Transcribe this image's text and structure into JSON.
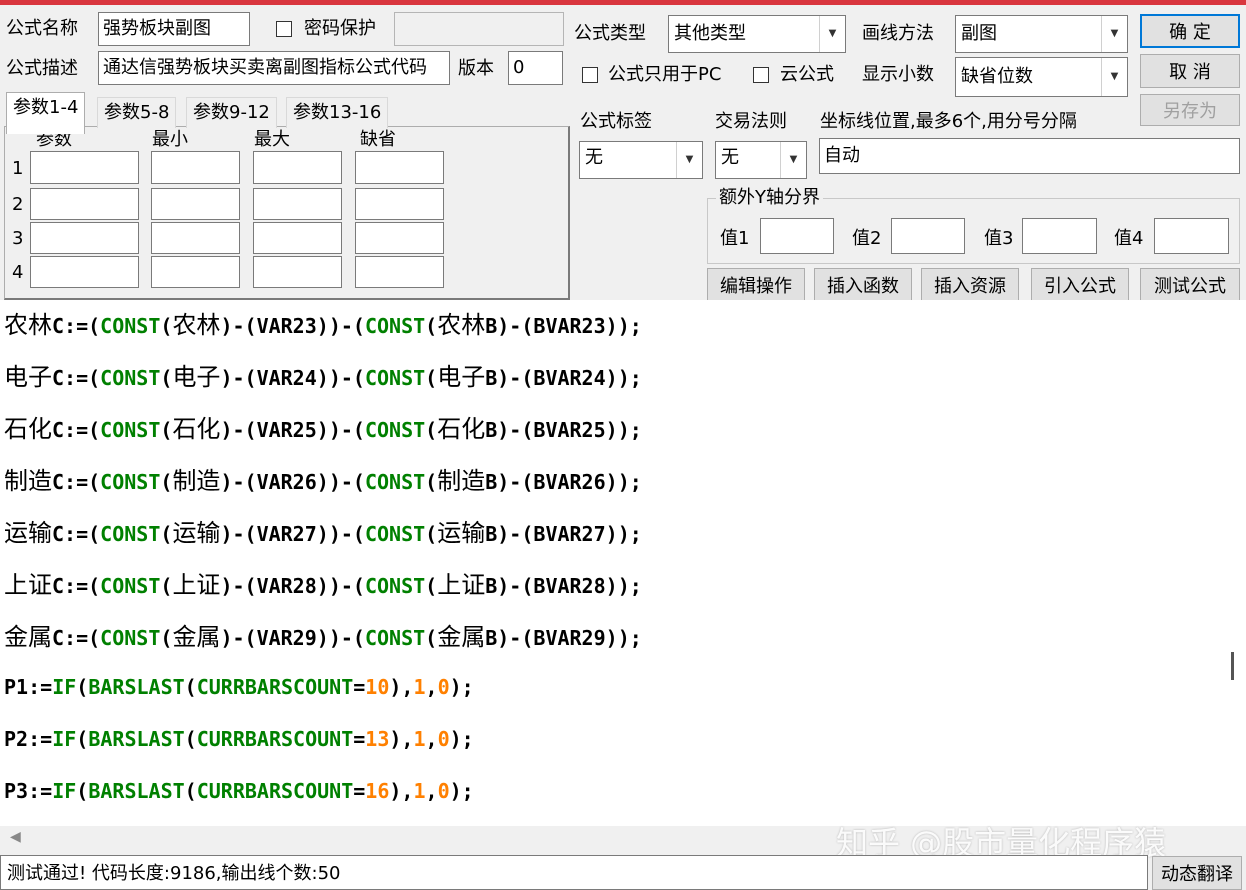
{
  "header": {
    "name_label": "公式名称",
    "name_value": "强势板块副图",
    "password_label": "密码保护",
    "desc_label": "公式描述",
    "desc_value": "通达信强势板块买卖离副图指标公式代码",
    "version_label": "版本",
    "version_value": "0",
    "type_label": "公式类型",
    "type_value": "其他类型",
    "draw_label": "画线方法",
    "draw_value": "副图",
    "pc_only_label": "公式只用于PC",
    "cloud_label": "云公式",
    "decimal_label": "显示小数",
    "decimal_value": "缺省位数"
  },
  "buttons": {
    "ok": "确  定",
    "cancel": "取  消",
    "save_as": "另存为"
  },
  "tabs": [
    "参数1-4",
    "参数5-8",
    "参数9-12",
    "参数13-16"
  ],
  "params": {
    "headers": [
      "参数",
      "最小",
      "最大",
      "缺省"
    ],
    "rows": [
      "1",
      "2",
      "3",
      "4"
    ]
  },
  "tag": {
    "label": "公式标签",
    "value": "无"
  },
  "rule": {
    "label": "交易法则",
    "value": "无"
  },
  "axis": {
    "label": "坐标线位置,最多6个,用分号分隔",
    "value": "自动"
  },
  "extra_y": {
    "title": "额外Y轴分界",
    "labels": [
      "值1",
      "值2",
      "值3",
      "值4"
    ]
  },
  "actions": [
    "编辑操作",
    "插入函数",
    "插入资源",
    "引入公式",
    "测试公式"
  ],
  "code": [
    {
      "sector": "农林",
      "var": "VAR23"
    },
    {
      "sector": "电子",
      "var": "VAR24"
    },
    {
      "sector": "石化",
      "var": "VAR25"
    },
    {
      "sector": "制造",
      "var": "VAR26"
    },
    {
      "sector": "运输",
      "var": "VAR27"
    },
    {
      "sector": "上证",
      "var": "VAR28"
    },
    {
      "sector": "金属",
      "var": "VAR29"
    }
  ],
  "code_p": [
    {
      "name": "P1",
      "n": "10"
    },
    {
      "name": "P2",
      "n": "13"
    },
    {
      "name": "P3",
      "n": "16"
    }
  ],
  "status": "测试通过! 代码长度:9186,输出线个数:50",
  "translate_button": "动态翻译",
  "watermark": "知乎 @股市量化程序猿"
}
